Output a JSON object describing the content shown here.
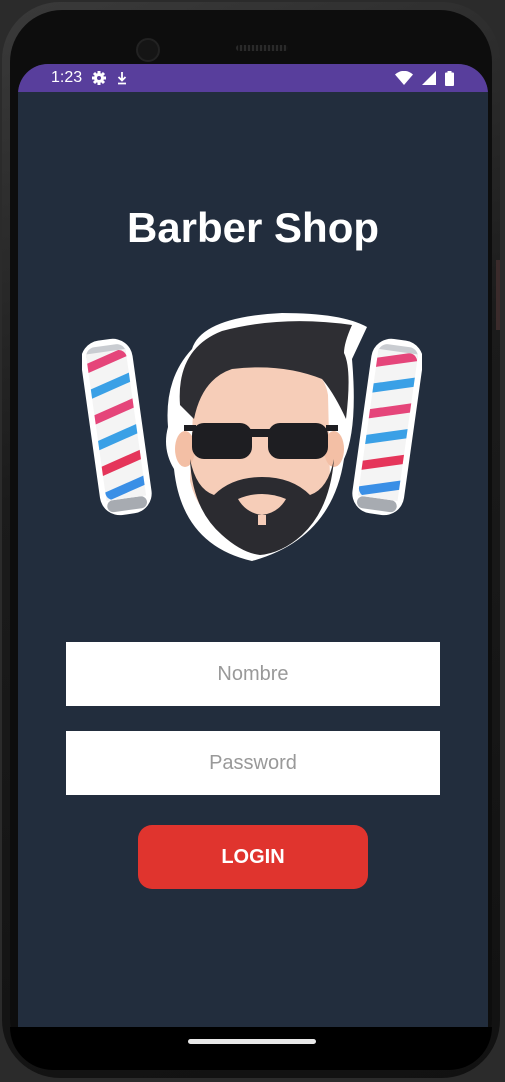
{
  "status_bar": {
    "time": "1:23",
    "icons": [
      "gear-icon",
      "download-icon",
      "wifi-icon",
      "signal-icon",
      "battery-icon"
    ]
  },
  "app": {
    "title": "Barber Shop",
    "logo": "barber-logo-icon"
  },
  "form": {
    "name_placeholder": "Nombre",
    "password_placeholder": "Password",
    "login_label": "LOGIN"
  },
  "colors": {
    "status_bar": "#583e9c",
    "background": "#222d3d",
    "button": "#e0342e"
  }
}
